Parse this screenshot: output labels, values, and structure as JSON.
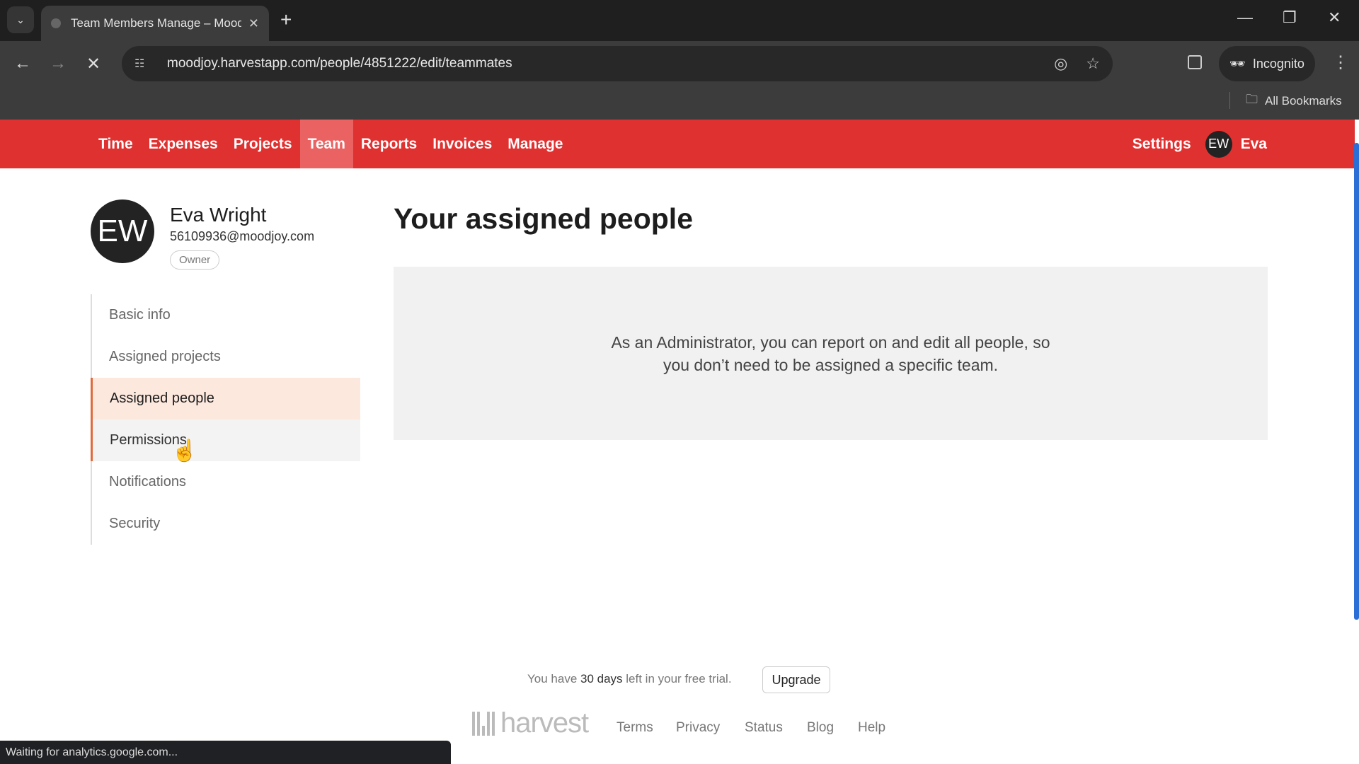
{
  "browser": {
    "tab_title": "Team Members Manage – Moodjoy",
    "url": "moodjoy.harvestapp.com/people/4851222/edit/teammates",
    "incognito_label": "Incognito",
    "bookmarks_label": "All Bookmarks",
    "status_text": "Waiting for analytics.google.com..."
  },
  "app_nav": {
    "items": [
      {
        "label": "Time"
      },
      {
        "label": "Expenses"
      },
      {
        "label": "Projects"
      },
      {
        "label": "Team",
        "active": true
      },
      {
        "label": "Reports"
      },
      {
        "label": "Invoices"
      },
      {
        "label": "Manage"
      }
    ],
    "settings_label": "Settings",
    "user_initials": "EW",
    "user_name": "Eva"
  },
  "profile": {
    "initials": "EW",
    "name": "Eva Wright",
    "email": "56109936@moodjoy.com",
    "role": "Owner"
  },
  "sidebar": {
    "items": [
      {
        "label": "Basic info"
      },
      {
        "label": "Assigned projects"
      },
      {
        "label": "Assigned people",
        "active": true
      },
      {
        "label": "Permissions",
        "hover": true
      },
      {
        "label": "Notifications"
      },
      {
        "label": "Security"
      }
    ]
  },
  "main": {
    "heading": "Your assigned people",
    "message": "As an Administrator, you can report on and edit all people, so you don’t need to be assigned a specific team."
  },
  "footer": {
    "trial_prefix": "You have ",
    "trial_days": "30 days",
    "trial_suffix": " left in your free trial.",
    "upgrade_label": "Upgrade",
    "logo_text": "harvest",
    "links": [
      "Terms",
      "Privacy",
      "Status",
      "Blog",
      "Help"
    ]
  },
  "colors": {
    "brand_red": "#e03131",
    "active_item_bg": "#fde8de",
    "accent_orange": "#e06a3c"
  }
}
